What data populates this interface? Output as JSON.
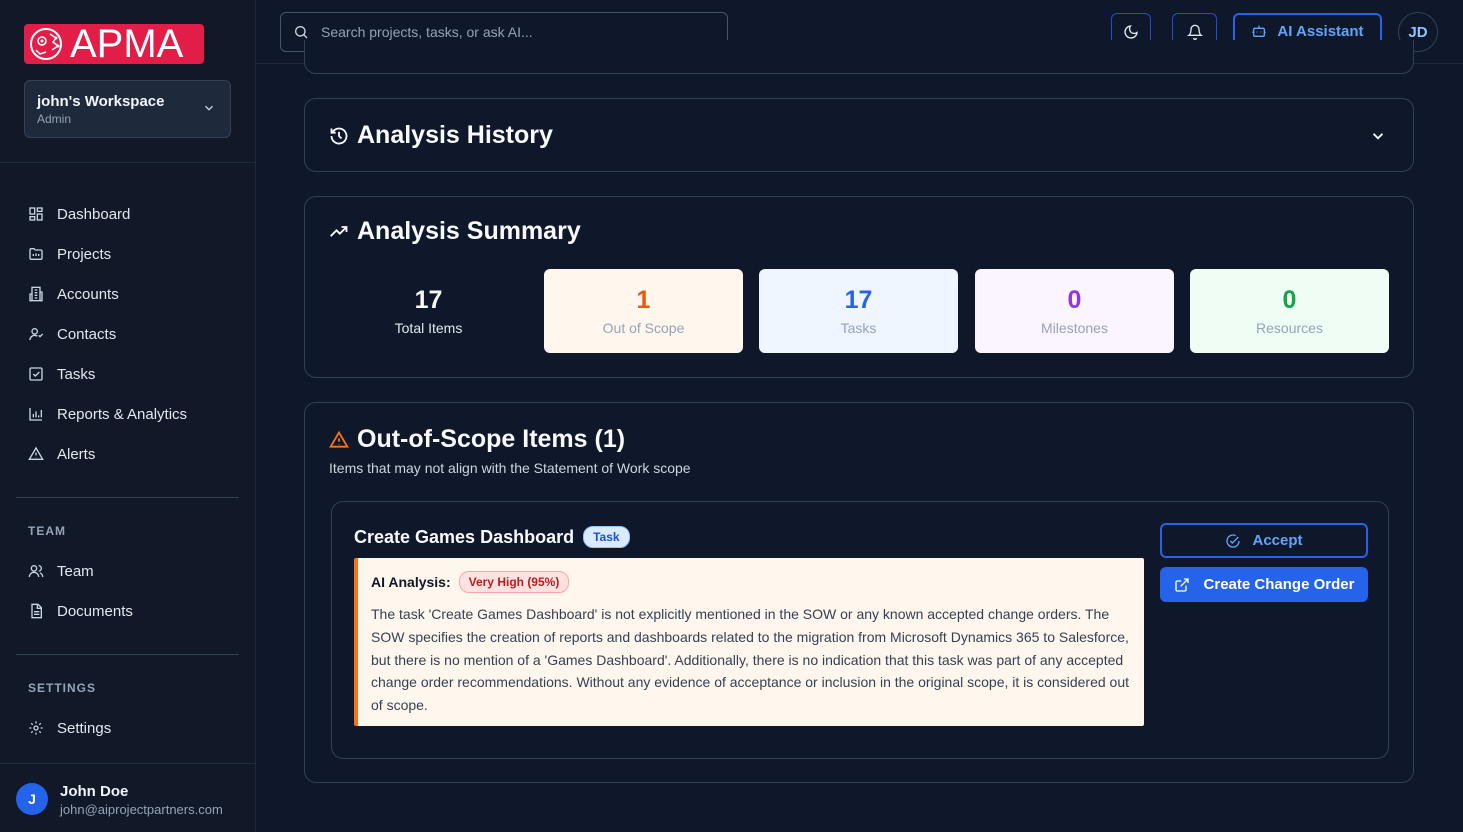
{
  "app": {
    "logo_text": "APMA"
  },
  "workspace": {
    "name": "john's Workspace",
    "role": "Admin"
  },
  "sidebar": {
    "items": [
      {
        "label": "Dashboard",
        "icon": "dashboard-icon"
      },
      {
        "label": "Projects",
        "icon": "folder-icon"
      },
      {
        "label": "Accounts",
        "icon": "building-icon"
      },
      {
        "label": "Contacts",
        "icon": "contact-icon"
      },
      {
        "label": "Tasks",
        "icon": "checkbox-icon"
      },
      {
        "label": "Reports & Analytics",
        "icon": "bar-chart-icon"
      },
      {
        "label": "Alerts",
        "icon": "alert-triangle-icon"
      }
    ],
    "team_heading": "TEAM",
    "team_items": [
      {
        "label": "Team",
        "icon": "users-icon"
      },
      {
        "label": "Documents",
        "icon": "document-icon"
      }
    ],
    "settings_heading": "SETTINGS",
    "settings_items": [
      {
        "label": "Settings",
        "icon": "gear-icon"
      }
    ]
  },
  "user": {
    "initial": "J",
    "name": "John Doe",
    "email": "john@aiprojectpartners.com"
  },
  "header": {
    "search_placeholder": "Search projects, tasks, or ask AI...",
    "ai_button": "AI Assistant",
    "avatar_initials": "JD"
  },
  "history": {
    "title": "Analysis History"
  },
  "summary": {
    "title": "Analysis Summary",
    "stats": [
      {
        "value": "17",
        "label": "Total Items",
        "color": "#f8fafc"
      },
      {
        "value": "1",
        "label": "Out of Scope",
        "color": "#ea580c",
        "bg": "#fff7ed"
      },
      {
        "value": "17",
        "label": "Tasks",
        "color": "#2563eb",
        "bg": "#eff6ff"
      },
      {
        "value": "0",
        "label": "Milestones",
        "color": "#9333ea",
        "bg": "#faf5ff"
      },
      {
        "value": "0",
        "label": "Resources",
        "color": "#16a34a",
        "bg": "#f0fdf4"
      }
    ]
  },
  "out_of_scope": {
    "title": "Out-of-Scope Items (1)",
    "subtitle": "Items that may not align with the Statement of Work scope",
    "item": {
      "name": "Create Games Dashboard",
      "type": "Task",
      "analysis_label": "AI Analysis:",
      "confidence": "Very High (95%)",
      "analysis": "The task 'Create Games Dashboard' is not explicitly mentioned in the SOW or any known accepted change orders. The SOW specifies the creation of reports and dashboards related to the migration from Microsoft Dynamics 365 to Salesforce, but there is no mention of a 'Games Dashboard'. Additionally, there is no indication that this task was part of any accepted change order recommendations. Without any evidence of acceptance or inclusion in the original scope, it is considered out of scope.",
      "accept_label": "Accept",
      "change_order_label": "Create Change Order"
    }
  },
  "colors": {
    "accent": "#2563eb",
    "brand": "#e11d48",
    "warning": "#f97316"
  }
}
